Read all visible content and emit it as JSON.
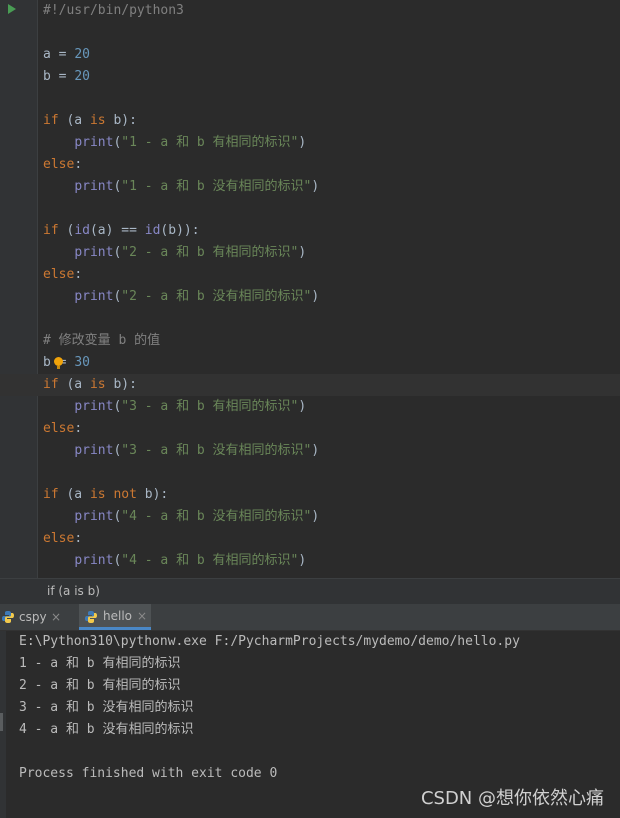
{
  "editor": {
    "lines": [
      "#!/usr/bin/python3",
      "",
      "a = 20",
      "b = 20",
      "",
      "if (a is b):",
      "    print(\"1 - a 和 b 有相同的标识\")",
      "else:",
      "    print(\"1 - a 和 b 没有相同的标识\")",
      "",
      "if (id(a) == id(b)):",
      "    print(\"2 - a 和 b 有相同的标识\")",
      "else:",
      "    print(\"2 - a 和 b 没有相同的标识\")",
      "",
      "# 修改变量 b 的值",
      "b = 30",
      "if (a is b):",
      "    print(\"3 - a 和 b 有相同的标识\")",
      "else:",
      "    print(\"3 - a 和 b 没有相同的标识\")",
      "",
      "if (a is not b):",
      "    print(\"4 - a 和 b 没有相同的标识\")",
      "else:",
      "    print(\"4 - a 和 b 有相同的标识\")"
    ]
  },
  "breadcrumb": {
    "text": "if (a is b)"
  },
  "run_tabs": [
    {
      "label": "cspy",
      "close": "×"
    },
    {
      "label": "hello",
      "close": "×"
    }
  ],
  "console": {
    "lines": [
      "E:\\Python310\\pythonw.exe F:/PycharmProjects/mydemo/demo/hello.py",
      "1 - a 和 b 有相同的标识",
      "2 - a 和 b 有相同的标识",
      "3 - a 和 b 没有相同的标识",
      "4 - a 和 b 没有相同的标识",
      "",
      "Process finished with exit code 0"
    ]
  },
  "watermark": "CSDN @想你依然心痛",
  "colors": {
    "background": "#2b2b2b",
    "keyword": "#cc7832",
    "builtin": "#8888c6",
    "string": "#6a8759",
    "number": "#6897bb",
    "comment": "#808080",
    "text": "#a9b7c6",
    "accent": "#4a88c7"
  }
}
